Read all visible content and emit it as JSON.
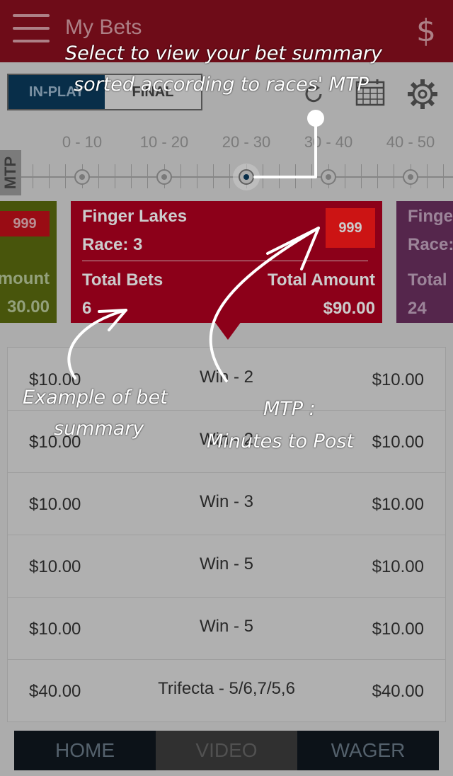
{
  "app_bar": {
    "title": "My Bets"
  },
  "icons": {
    "menu": "menu-icon",
    "currency": "dollar-icon",
    "refresh": "refresh-icon",
    "calendar": "calendar-icon",
    "settings": "gear-icon"
  },
  "toggle": {
    "in_play": "IN-PLAY",
    "final": "FINAL",
    "selected": "IN-PLAY"
  },
  "mtp_scale": {
    "label": "MTP",
    "ranges": [
      "0 - 10",
      "10 - 20",
      "20 - 30",
      "30 - 40",
      "40 - 50"
    ],
    "selected_range": "20 - 30"
  },
  "cards": {
    "left": {
      "badge": "999",
      "amount_label": "mount",
      "amount": "30.00"
    },
    "main": {
      "track": "Finger Lakes",
      "race": "Race: 3",
      "badge": "999",
      "total_bets_label": "Total Bets",
      "total_bets": "6",
      "total_amount_label": "Total Amount",
      "total_amount": "$90.00"
    },
    "right": {
      "track": "Finge",
      "race": "Race:",
      "total_label": "Total",
      "total": "24"
    }
  },
  "bets": [
    {
      "stake": "$10.00",
      "bet": "Win - 2",
      "amount": "$10.00"
    },
    {
      "stake": "$10.00",
      "bet": "Win - 2",
      "amount": "$10.00"
    },
    {
      "stake": "$10.00",
      "bet": "Win - 3",
      "amount": "$10.00"
    },
    {
      "stake": "$10.00",
      "bet": "Win - 5",
      "amount": "$10.00"
    },
    {
      "stake": "$10.00",
      "bet": "Win - 5",
      "amount": "$10.00"
    },
    {
      "stake": "$40.00",
      "bet": "Trifecta - 5/6,7/5,6",
      "amount": "$40.00"
    }
  ],
  "tabs": {
    "home": "HOME",
    "video": "VIDEO",
    "wager": "WAGER"
  },
  "annotations": {
    "select_line1": "Select to view your bet summary",
    "select_line2": "sorted according to races' MTP",
    "example_line1": "Example of bet",
    "example_line2": "summary",
    "mtp_line1": "MTP :",
    "mtp_line2": "Minutes to Post"
  },
  "colors": {
    "app_bar": "#8a0f1e",
    "card_main": "#b00020",
    "badge": "#ff1a1a",
    "toggle_on": "#0a3a5c"
  }
}
